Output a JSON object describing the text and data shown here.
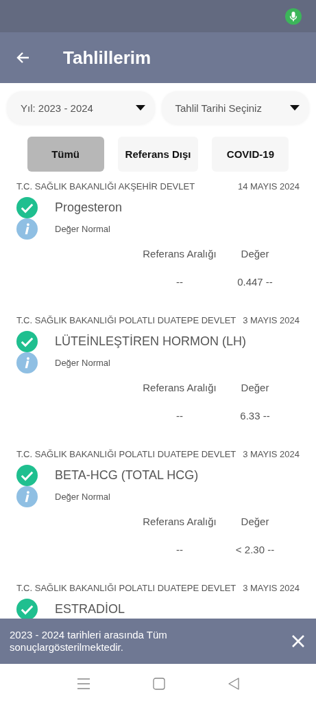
{
  "app_bar": {
    "title": "Tahlillerim"
  },
  "filters": [
    {
      "value": "Yıl: 2023 - 2024"
    },
    {
      "value": "Tahlil Tarihi Seçiniz"
    }
  ],
  "tabs": [
    {
      "label": "Tümü",
      "selected": true
    },
    {
      "label": "Referans Dışı",
      "selected": false
    },
    {
      "label": "COVID-19",
      "selected": false
    }
  ],
  "results": [
    {
      "hospital": "T.C. SAĞLIK BAKANLIĞI AKŞEHİR DEVLET",
      "date": "14 MAYIS 2024",
      "test": "Progesteron",
      "note": "Değer Normal",
      "ref_header": "Referans Aralığı",
      "value_header": "Değer",
      "reference": "--",
      "value": "0.447 --"
    },
    {
      "hospital": "T.C. SAĞLIK BAKANLIĞI POLATLI DUATEPE DEVLET",
      "date": "3 MAYIS 2024",
      "test": "LÜTEİNLEŞTİREN HORMON (LH)",
      "note": "Değer Normal",
      "ref_header": "Referans Aralığı",
      "value_header": "Değer",
      "reference": "--",
      "value": "6.33 --"
    },
    {
      "hospital": "T.C. SAĞLIK BAKANLIĞI POLATLI DUATEPE DEVLET",
      "date": "3 MAYIS 2024",
      "test": "BETA-HCG (TOTAL HCG)",
      "note": "Değer Normal",
      "ref_header": "Referans Aralığı",
      "value_header": "Değer",
      "reference": "--",
      "value": "< 2.30 --"
    },
    {
      "hospital": "T.C. SAĞLIK BAKANLIĞI POLATLI DUATEPE DEVLET",
      "date": "3 MAYIS 2024",
      "test": "ESTRADİOL"
    }
  ],
  "snackbar": {
    "message": "2023 - 2024 tarihleri arasında Tüm sonuçlargösterilmektedir."
  }
}
